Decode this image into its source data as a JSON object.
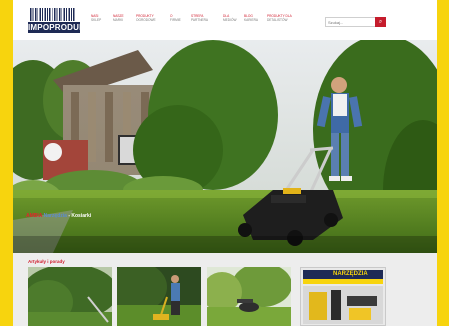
{
  "header": {
    "logo_text": "IMPOPRODUKT",
    "nav": [
      {
        "label": "NASI",
        "sub": "SKLEP"
      },
      {
        "label": "NASZE",
        "sub": "MARKI"
      },
      {
        "label": "PRODUKTY",
        "sub": "OGRODOWE"
      },
      {
        "label": "O",
        "sub": "FIRMIE"
      },
      {
        "label": "STREFA",
        "sub": "PARTNERA"
      },
      {
        "label": "DLA",
        "sub": "MEDIÓW"
      },
      {
        "label": "BLOG",
        "sub": "KARIERA"
      },
      {
        "label": "PRODUKTY DLA",
        "sub": "DETALISTÓW"
      }
    ],
    "search_placeholder": "Szukaj..."
  },
  "hero": {
    "caption": {
      "part1": "AMBIA",
      "part2": "Narzędzia",
      "sep": "-",
      "part3": "Kosiarki"
    }
  },
  "articles": {
    "title": "Artykuły i porady",
    "promo_label": "NARZĘDZIA"
  },
  "colors": {
    "background": "#f7d40e",
    "accent_red": "#cf1b2c",
    "brand_navy": "#1e2a55"
  }
}
